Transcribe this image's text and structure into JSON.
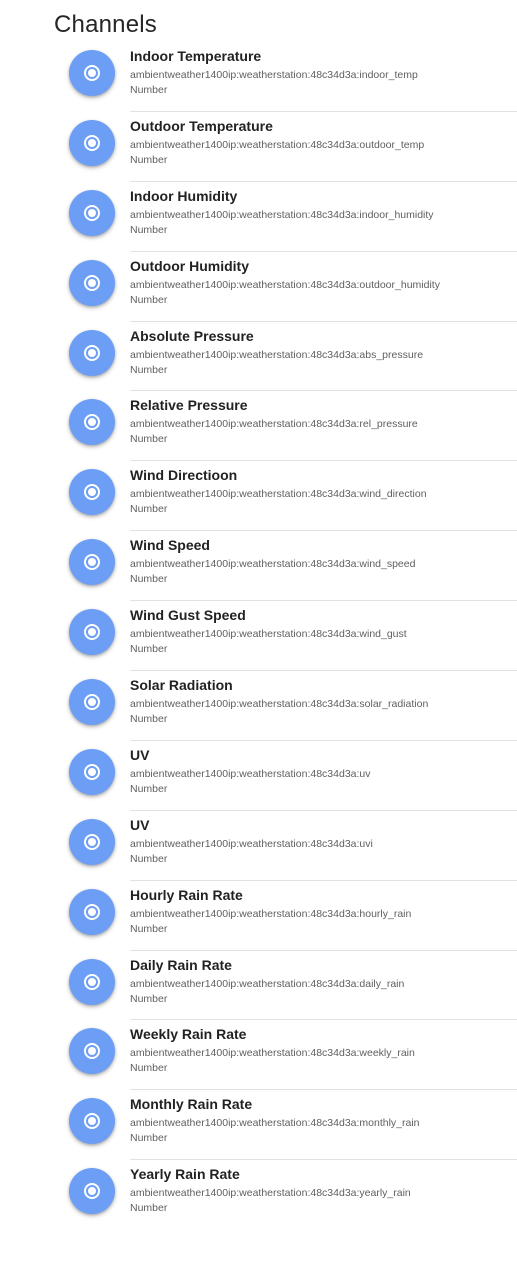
{
  "page": {
    "title": "Channels"
  },
  "colors": {
    "icon_background": "#6c9ef5",
    "icon_foreground": "#ffffff",
    "divider": "#e2e2e2"
  },
  "channels": [
    {
      "label": "Indoor Temperature",
      "uid": "ambientweather1400ip:weatherstation:48c34d3a:indoor_temp",
      "type": "Number",
      "icon": "radio-button-checked-icon"
    },
    {
      "label": "Outdoor Temperature",
      "uid": "ambientweather1400ip:weatherstation:48c34d3a:outdoor_temp",
      "type": "Number",
      "icon": "radio-button-checked-icon"
    },
    {
      "label": "Indoor Humidity",
      "uid": "ambientweather1400ip:weatherstation:48c34d3a:indoor_humidity",
      "type": "Number",
      "icon": "radio-button-checked-icon"
    },
    {
      "label": "Outdoor Humidity",
      "uid": "ambientweather1400ip:weatherstation:48c34d3a:outdoor_humidity",
      "type": "Number",
      "icon": "radio-button-checked-icon"
    },
    {
      "label": "Absolute Pressure",
      "uid": "ambientweather1400ip:weatherstation:48c34d3a:abs_pressure",
      "type": "Number",
      "icon": "radio-button-checked-icon"
    },
    {
      "label": "Relative Pressure",
      "uid": "ambientweather1400ip:weatherstation:48c34d3a:rel_pressure",
      "type": "Number",
      "icon": "radio-button-checked-icon"
    },
    {
      "label": "Wind Directioon",
      "uid": "ambientweather1400ip:weatherstation:48c34d3a:wind_direction",
      "type": "Number",
      "icon": "radio-button-checked-icon"
    },
    {
      "label": "Wind Speed",
      "uid": "ambientweather1400ip:weatherstation:48c34d3a:wind_speed",
      "type": "Number",
      "icon": "radio-button-checked-icon"
    },
    {
      "label": "Wind Gust Speed",
      "uid": "ambientweather1400ip:weatherstation:48c34d3a:wind_gust",
      "type": "Number",
      "icon": "radio-button-checked-icon"
    },
    {
      "label": "Solar Radiation",
      "uid": "ambientweather1400ip:weatherstation:48c34d3a:solar_radiation",
      "type": "Number",
      "icon": "radio-button-checked-icon"
    },
    {
      "label": "UV",
      "uid": "ambientweather1400ip:weatherstation:48c34d3a:uv",
      "type": "Number",
      "icon": "radio-button-checked-icon"
    },
    {
      "label": "UV",
      "uid": "ambientweather1400ip:weatherstation:48c34d3a:uvi",
      "type": "Number",
      "icon": "radio-button-checked-icon"
    },
    {
      "label": "Hourly Rain Rate",
      "uid": "ambientweather1400ip:weatherstation:48c34d3a:hourly_rain",
      "type": "Number",
      "icon": "radio-button-checked-icon"
    },
    {
      "label": "Daily Rain Rate",
      "uid": "ambientweather1400ip:weatherstation:48c34d3a:daily_rain",
      "type": "Number",
      "icon": "radio-button-checked-icon"
    },
    {
      "label": "Weekly Rain Rate",
      "uid": "ambientweather1400ip:weatherstation:48c34d3a:weekly_rain",
      "type": "Number",
      "icon": "radio-button-checked-icon"
    },
    {
      "label": "Monthly Rain Rate",
      "uid": "ambientweather1400ip:weatherstation:48c34d3a:monthly_rain",
      "type": "Number",
      "icon": "radio-button-checked-icon"
    },
    {
      "label": "Yearly Rain Rate",
      "uid": "ambientweather1400ip:weatherstation:48c34d3a:yearly_rain",
      "type": "Number",
      "icon": "radio-button-checked-icon"
    }
  ]
}
